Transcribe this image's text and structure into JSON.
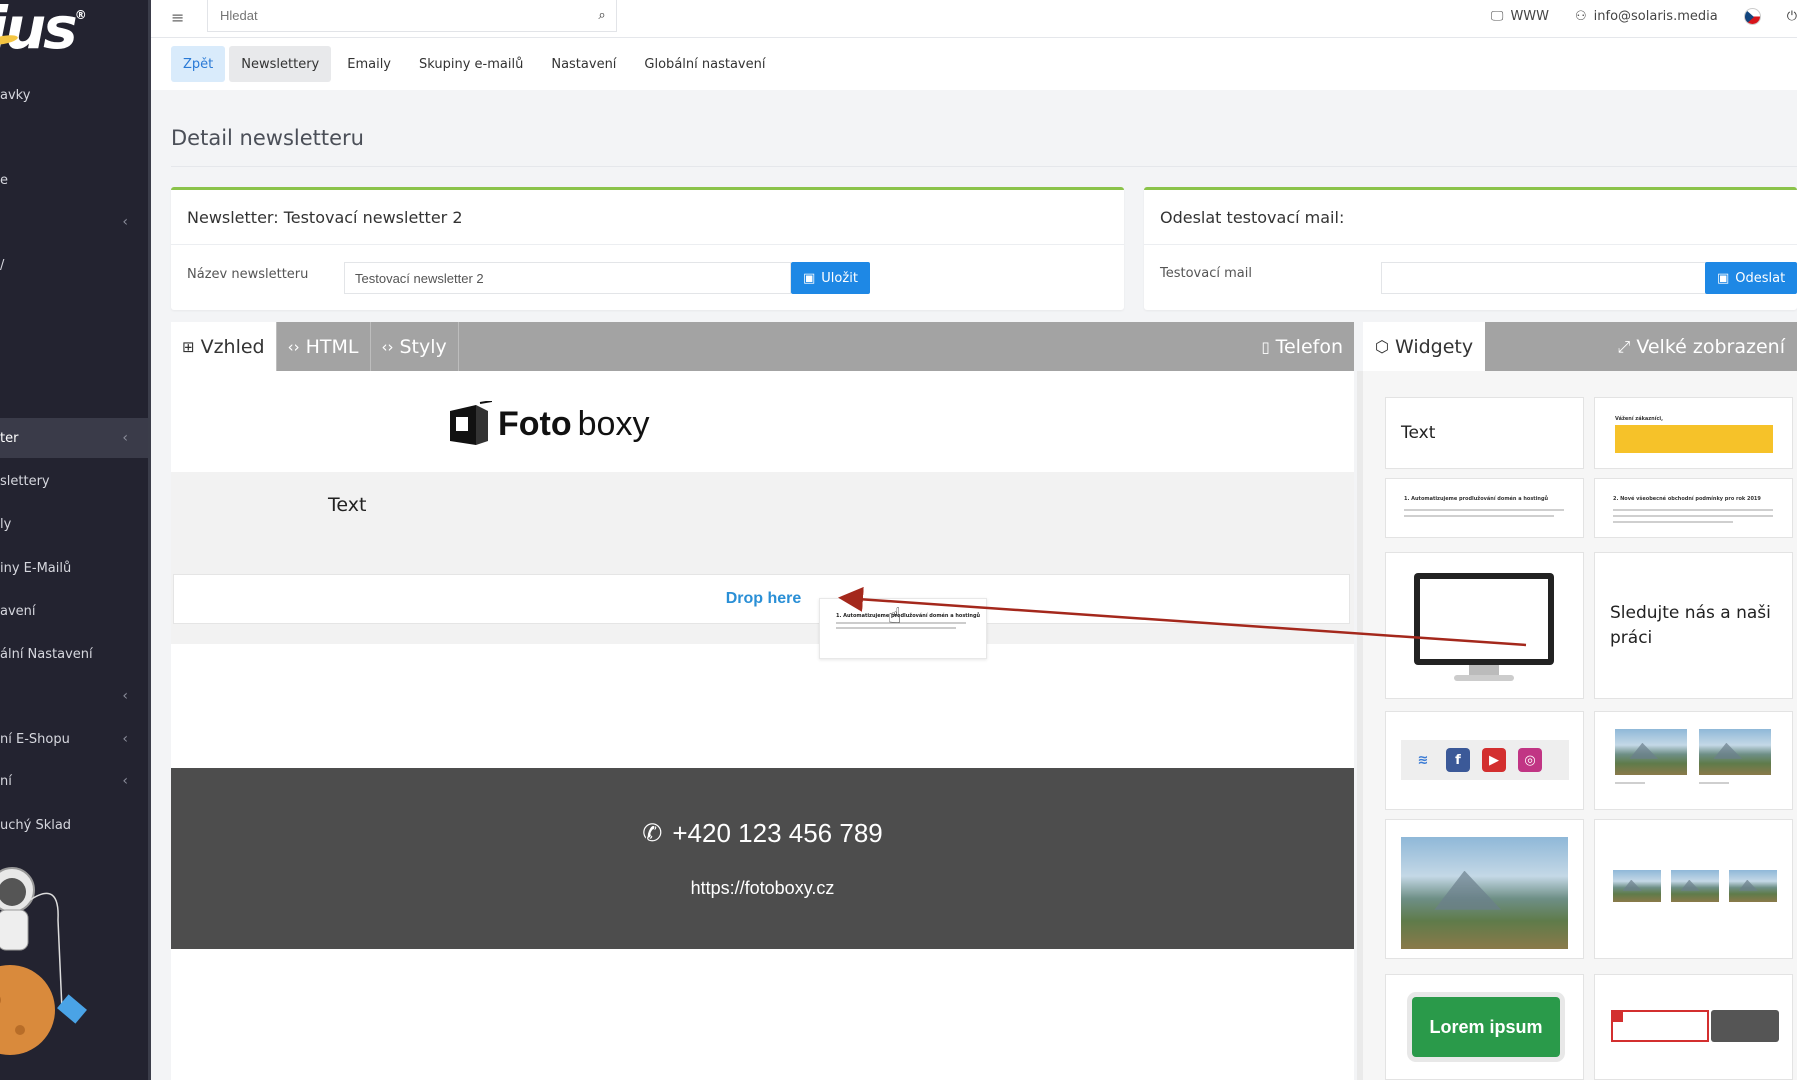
{
  "sidebar": {
    "logo_text": "ius",
    "items": [
      {
        "label": "avky",
        "chevron": false
      },
      {
        "label": "e",
        "chevron": false
      },
      {
        "label": "",
        "chevron": true
      },
      {
        "label": "/",
        "chevron": false
      },
      {
        "label": "ter",
        "chevron": true,
        "active": true
      },
      {
        "label": "slettery",
        "chevron": false
      },
      {
        "label": "ly",
        "chevron": false
      },
      {
        "label": "iny E-Mailů",
        "chevron": false
      },
      {
        "label": "avení",
        "chevron": false
      },
      {
        "label": "ální Nastavení",
        "chevron": false
      },
      {
        "label": "",
        "chevron": true
      },
      {
        "label": "ní E-Shopu",
        "chevron": true
      },
      {
        "label": "ní",
        "chevron": true
      },
      {
        "label": "uchý Sklad",
        "chevron": false
      }
    ]
  },
  "topbar": {
    "search_placeholder": "Hledat",
    "www_label": "WWW",
    "user_email": "info@solaris.media"
  },
  "tabs": {
    "back": "Zpět",
    "items": [
      "Newslettery",
      "Emaily",
      "Skupiny e-mailů",
      "Nastavení",
      "Globální nastavení"
    ]
  },
  "page": {
    "title": "Detail newsletteru"
  },
  "newsletter_card": {
    "header": "Newsletter: Testovací newsletter 2",
    "name_label": "Název newsletteru",
    "name_value": "Testovací newsletter 2",
    "save_label": "Uložit"
  },
  "test_mail_card": {
    "header": "Odeslat testovací mail:",
    "mail_label": "Testovací mail",
    "mail_value": "",
    "send_label": "Odeslat"
  },
  "editor": {
    "tabs": {
      "design": "Vzhled",
      "html": "HTML",
      "styles": "Styly",
      "phone": "Telefon"
    },
    "logo_bold": "Foto",
    "logo_light": "boxy",
    "text_block": "Text",
    "drop_here": "Drop here",
    "ghost_title": "1. Automatizujeme prodlužování domén a hostingů",
    "phone": "+420 123 456 789",
    "url": "https://fotoboxy.cz"
  },
  "widgets": {
    "tab_label": "Widgety",
    "fullscreen_label": "Velké zobrazení",
    "text_widget": "Text",
    "follow_widget": "Sledujte nás a naši práci",
    "lorem_widget": "Lorem ipsum",
    "mini_titles": [
      "Vážení zákazníci,",
      "1. Automatizujeme prodlužování domén a hostingů",
      "2. Nové všeobecné obchodní podmínky pro rok 2019"
    ]
  },
  "colors": {
    "sidebar_bg": "#232330",
    "accent_blue": "#1e88e5",
    "card_top_green": "#8bc34a",
    "footer_dark": "#4d4d4d",
    "drop_blue": "#2a8fd6",
    "arrow_red": "#a4281c",
    "lorem_green": "#2a9a4a"
  }
}
